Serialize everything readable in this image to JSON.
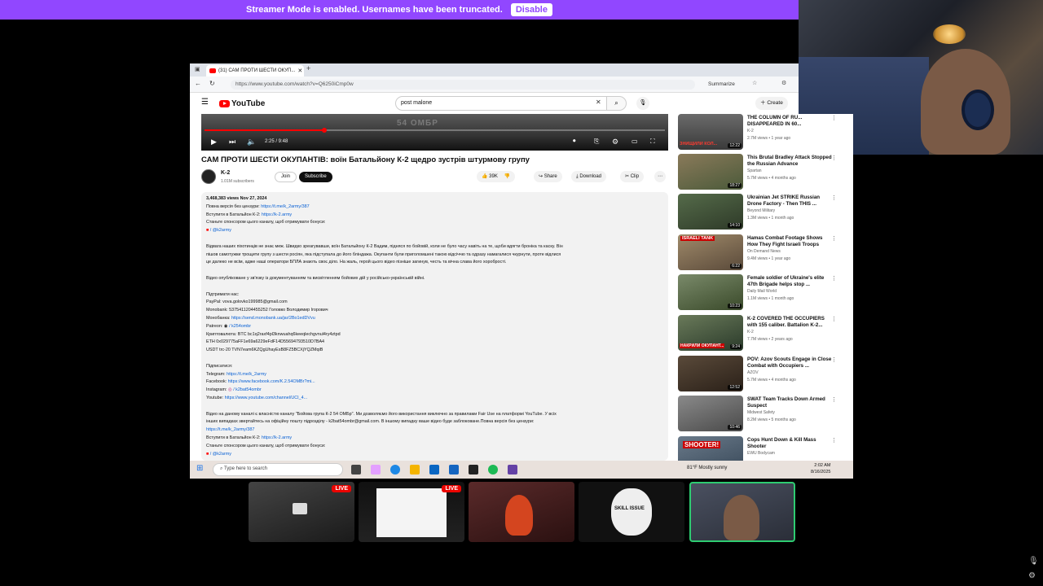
{
  "banner": {
    "message": "Streamer Mode is enabled. Usernames have been truncated.",
    "disable_label": "Disable",
    "color": "#9147ff"
  },
  "browser": {
    "tab_title": "(31) САМ ПРОТИ ШЕСТИ ОКУП...",
    "url": "https://www.youtube.com/watch?v=Q6250iCmp0w",
    "summarize_label": "Summarize"
  },
  "youtube": {
    "logo_text": "YouTube",
    "search_value": "post malone",
    "create_label": "Create",
    "player": {
      "watermark": "54 ОМБР",
      "timecode": "2:25 / 9:48",
      "progress_fraction": 0.26
    },
    "video": {
      "title": "САМ ПРОТИ ШЕСТИ ОКУПАНТІВ: воїн Батальйону К-2 щедро зустрів штурмову групу",
      "channel": "K-2",
      "subscribers": "1.01M subscribers",
      "join_label": "Join",
      "subscribe_label": "Subscribe",
      "likes": "39K",
      "share_label": "Share",
      "download_label": "Download",
      "clip_label": "Clip"
    },
    "description": {
      "views_date": "3,468,383 views  Nov 27, 2024",
      "l1_text": "Повна версія без цензури: ",
      "l1_link": "https://t.me/k_2army/387",
      "l2_text": "Вступити в Батальйон К-2: ",
      "l2_link": "https://k-2.army",
      "l3_text": "Станьте спонсором цього каналу, щоб отримувати бонуси:",
      "l4_text": "/ @k2army",
      "p1": "Відвага наших піхотинців не знає меж. Швидко зреагувавши, воїн Батальйону К-2 Вадим, підняся по бойовій, коли не було часу навіть на те, щоби вдягти броніка та каску. Він",
      "p2": "пішов самотужки трощити групу з шести росіян, яка підступала до його бліндажа. Окупанти були приголомшені такою відсіччю та одразу намагалися чкурнути, проте відлися",
      "p3": "це далеко не всім, адже наші оператори БПЛА знають своє діло. На жаль, герой цього відео пізніше загинув, честь та вічна слава його хоробрості.",
      "p4": "Відео опубліковане у зв'язку із документуванням та висвітленням бойових дій у російсько-українській війні.",
      "support_title": "Підтримати нас:",
      "paypal": "PayPal: vova.golovko199985@gmail.com",
      "monobank_card": "Monobank: 5375411204455252 Головко Володимир Ігорович",
      "monobanka_text": "Монобанка: ",
      "monobanka_link": "https://send.monobank.ua/jar/2Bo1edDVvu",
      "patreon": "Patreon:",
      "patreon_handle": "/ k254ombr",
      "crypto": "Криптовалюта: BTC bc1q2raxf4pl3knwuahq6keeqlechgvnul4ry4ztpd",
      "eth": "ETH 0x029775aFF1e69a6229eFdF14D55694793510D7BA4",
      "usdt": "USDT trc-20 TVN7eam6KZQgUhayEsB8FZ5BCXjYQZMqiB",
      "follow_title": "Підписатися:",
      "telegram_text": "Telegram: ",
      "telegram_link": "https://t.me/k_2army",
      "facebook_text": "Facebook: ",
      "facebook_link": "https://www.facebook.com/K.2.54OMBr?mi...",
      "instagram_text": "Instagram: ",
      "instagram_handle": "/ k2bat54ombr",
      "youtube_text": "Youtube: ",
      "youtube_link": "https://www.youtube.com/channel/UCI_4...",
      "fair1": "Відео на даному каналі є власністю каналу \"Бойова група К-2 54 ОМБр\". Ми дозволяємо його використання виключно за правилами Fair Use на платформі YouTube. У всіх",
      "fair2": "інших випадках звертайтесь на офіційну пошту підрозділу - k2bat54ombr@gmail.com. В іншому випадку ваше відео буде заблоковане.Повна версія без цензури:",
      "fair3_link": "https://t.me/k_2army/387",
      "l5_text": "Вступити в Батальйон К-2: ",
      "l5_link": "https://k-2.army",
      "l6_text": "Станьте спонсором цього каналу, щоб отримувати бонуси:",
      "l7_text": "/ @k2army"
    },
    "recommendations": [
      {
        "title": "THE COLUMN OF RU... DISAPPEARED IN 60...",
        "channel": "K-2",
        "meta": "2.7M views • 1 year ago",
        "duration": "12:22",
        "thumb_text": "ЗНИЩИЛИ КОЛ..."
      },
      {
        "title": "This Brutal Bradley Attack Stopped the Russian Advance",
        "channel": "Spartan",
        "meta": "5.7M views • 4 months ago",
        "duration": "18:27",
        "thumb_text": ""
      },
      {
        "title": "Ukrainian Jet STRIKE Russian Drone Factory - Then THIS ...",
        "channel": "Beyond Military",
        "meta": "1.3M views • 1 month ago",
        "duration": "14:10",
        "thumb_text": ""
      },
      {
        "title": "Hamas Combat Footage Shows How They Fight Israeli Troops",
        "channel": "On Demand News",
        "meta": "9.4M views • 1 year ago",
        "duration": "6:22",
        "thumb_text": "ISRAELI TANK"
      },
      {
        "title": "Female soldier of Ukraine's elite 47th Brigade helps stop ...",
        "channel": "Daily Mail World",
        "meta": "1.1M views • 1 month ago",
        "duration": "10:23",
        "thumb_text": ""
      },
      {
        "title": "K-2 COVERED THE OCCUPIERS with 155 caliber. Battalion K-2...",
        "channel": "K-2",
        "meta": "7.7M views • 2 years ago",
        "duration": "9:24",
        "thumb_text": "НАКРИЛИ ОКУПАНТ..."
      },
      {
        "title": "POV: Azov Scouts Engage in Close Combat with Occupiers ...",
        "channel": "AZOV",
        "meta": "5.7M views • 4 months ago",
        "duration": "12:52",
        "thumb_text": ""
      },
      {
        "title": "SWAT Team Tracks Down Armed Suspect",
        "channel": "Midwest Safety",
        "meta": "8.2M views • 5 months ago",
        "duration": "10:46",
        "thumb_text": ""
      },
      {
        "title": "Cops Hunt Down & Kill Mass Shooter",
        "channel": "EWU Bodycam",
        "meta": "",
        "duration": "",
        "thumb_text": "SHOOTER!"
      }
    ]
  },
  "taskbar": {
    "search_placeholder": "Type here to search",
    "weather": "81°F  Mostly sunny",
    "time": "2:02 AM",
    "date": "8/16/2025"
  },
  "streams": [
    {
      "live_label": "LIVE"
    },
    {
      "live_label": "LIVE"
    },
    {
      "live_label": ""
    },
    {
      "live_label": "",
      "thumb_text": "SKILL ISSUE"
    },
    {
      "live_label": ""
    }
  ]
}
